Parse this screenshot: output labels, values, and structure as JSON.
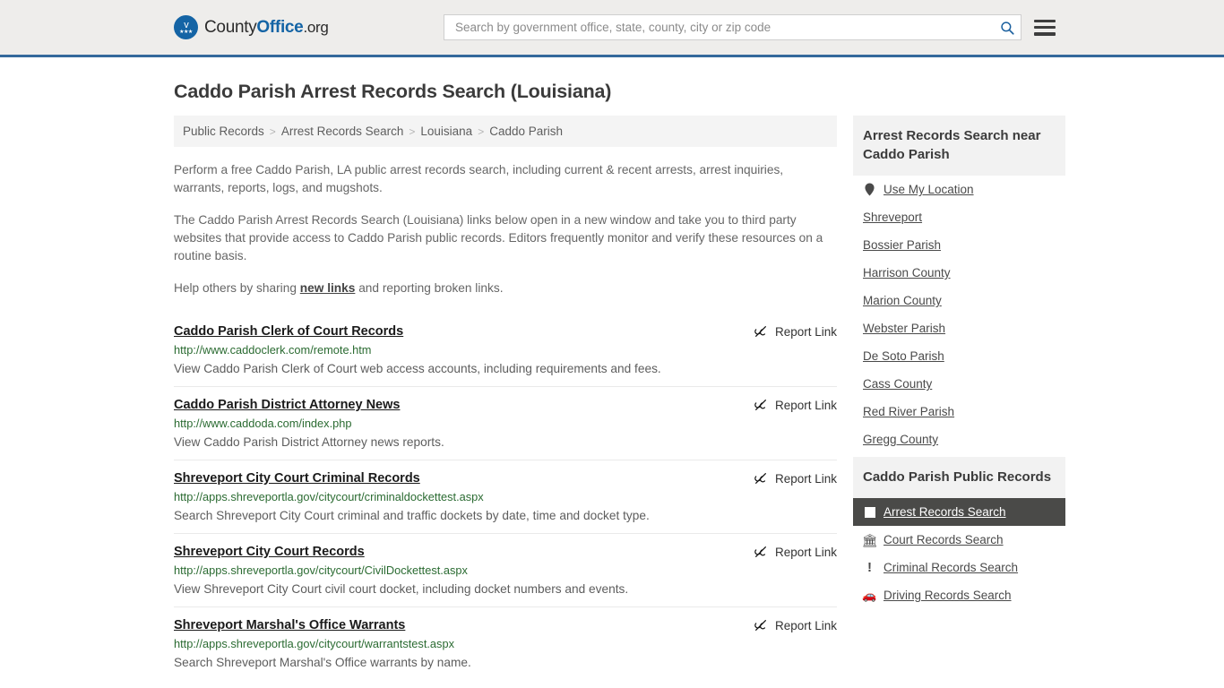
{
  "header": {
    "logo": {
      "text_part1": "County",
      "text_part2": "Office",
      "text_part3": ".org",
      "eagle_glyph": "ᴠ",
      "stars_glyph": "★★★"
    },
    "search": {
      "placeholder": "Search by government office, state, county, city or zip code",
      "value": ""
    }
  },
  "page_title": "Caddo Parish Arrest Records Search (Louisiana)",
  "breadcrumb": {
    "items": [
      {
        "label": "Public Records",
        "current": false
      },
      {
        "label": "Arrest Records Search",
        "current": false
      },
      {
        "label": "Louisiana",
        "current": false
      },
      {
        "label": "Caddo Parish",
        "current": true
      }
    ],
    "separator": ">"
  },
  "intro": {
    "p1": "Perform a free Caddo Parish, LA public arrest records search, including current & recent arrests, arrest inquiries, warrants, reports, logs, and mugshots.",
    "p2": "The Caddo Parish Arrest Records Search (Louisiana) links below open in a new window and take you to third party websites that provide access to Caddo Parish public records. Editors frequently monitor and verify these resources on a routine basis.",
    "p3_before": "Help others by sharing ",
    "p3_link": "new links",
    "p3_after": " and reporting broken links."
  },
  "report_link_label": "Report Link",
  "results": [
    {
      "title": "Caddo Parish Clerk of Court Records",
      "url": "http://www.caddoclerk.com/remote.htm",
      "description": "View Caddo Parish Clerk of Court web access accounts, including requirements and fees."
    },
    {
      "title": "Caddo Parish District Attorney News",
      "url": "http://www.caddoda.com/index.php",
      "description": "View Caddo Parish District Attorney news reports."
    },
    {
      "title": "Shreveport City Court Criminal Records",
      "url": "http://apps.shreveportla.gov/citycourt/criminaldockettest.aspx",
      "description": "Search Shreveport City Court criminal and traffic dockets by date, time and docket type."
    },
    {
      "title": "Shreveport City Court Records",
      "url": "http://apps.shreveportla.gov/citycourt/CivilDockettest.aspx",
      "description": "View Shreveport City Court civil court docket, including docket numbers and events."
    },
    {
      "title": "Shreveport Marshal's Office Warrants",
      "url": "http://apps.shreveportla.gov/citycourt/warrantstest.aspx",
      "description": "Search Shreveport Marshal's Office warrants by name."
    }
  ],
  "sidebar": {
    "nearby": {
      "header": "Arrest Records Search near Caddo Parish",
      "items": [
        {
          "label": "Use My Location",
          "icon": "map-pin-icon"
        },
        {
          "label": "Shreveport",
          "icon": ""
        },
        {
          "label": "Bossier Parish",
          "icon": ""
        },
        {
          "label": "Harrison County",
          "icon": ""
        },
        {
          "label": "Marion County",
          "icon": ""
        },
        {
          "label": "Webster Parish",
          "icon": ""
        },
        {
          "label": "De Soto Parish",
          "icon": ""
        },
        {
          "label": "Cass County",
          "icon": ""
        },
        {
          "label": "Red River Parish",
          "icon": ""
        },
        {
          "label": "Gregg County",
          "icon": ""
        }
      ]
    },
    "public_records": {
      "header": "Caddo Parish Public Records",
      "items": [
        {
          "label": "Arrest Records Search",
          "icon": "square-icon",
          "active": true
        },
        {
          "label": "Court Records Search",
          "icon": "bank-icon",
          "active": false
        },
        {
          "label": "Criminal Records Search",
          "icon": "exclamation-icon",
          "active": false
        },
        {
          "label": "Driving Records Search",
          "icon": "car-icon",
          "active": false
        }
      ]
    }
  },
  "colors": {
    "header_bg": "#eeedeb",
    "header_border": "#34699b",
    "brand_blue": "#1464a5",
    "url_green": "#2b6b32",
    "active_bg": "#4a4a48",
    "panel_gray": "#f2f2f2"
  }
}
